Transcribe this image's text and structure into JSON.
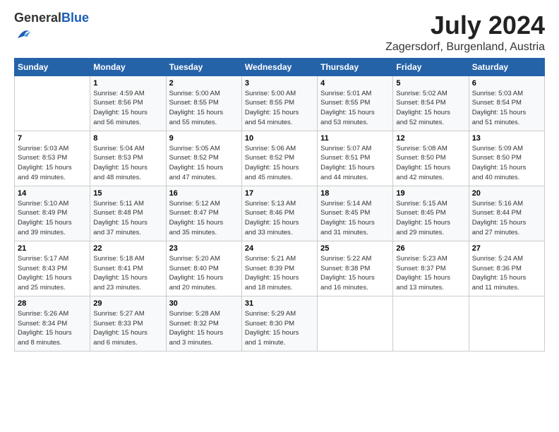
{
  "header": {
    "logo_general": "General",
    "logo_blue": "Blue",
    "title": "July 2024",
    "subtitle": "Zagersdorf, Burgenland, Austria"
  },
  "days_of_week": [
    "Sunday",
    "Monday",
    "Tuesday",
    "Wednesday",
    "Thursday",
    "Friday",
    "Saturday"
  ],
  "weeks": [
    [
      {
        "num": "",
        "info": ""
      },
      {
        "num": "1",
        "info": "Sunrise: 4:59 AM\nSunset: 8:56 PM\nDaylight: 15 hours\nand 56 minutes."
      },
      {
        "num": "2",
        "info": "Sunrise: 5:00 AM\nSunset: 8:55 PM\nDaylight: 15 hours\nand 55 minutes."
      },
      {
        "num": "3",
        "info": "Sunrise: 5:00 AM\nSunset: 8:55 PM\nDaylight: 15 hours\nand 54 minutes."
      },
      {
        "num": "4",
        "info": "Sunrise: 5:01 AM\nSunset: 8:55 PM\nDaylight: 15 hours\nand 53 minutes."
      },
      {
        "num": "5",
        "info": "Sunrise: 5:02 AM\nSunset: 8:54 PM\nDaylight: 15 hours\nand 52 minutes."
      },
      {
        "num": "6",
        "info": "Sunrise: 5:03 AM\nSunset: 8:54 PM\nDaylight: 15 hours\nand 51 minutes."
      }
    ],
    [
      {
        "num": "7",
        "info": "Sunrise: 5:03 AM\nSunset: 8:53 PM\nDaylight: 15 hours\nand 49 minutes."
      },
      {
        "num": "8",
        "info": "Sunrise: 5:04 AM\nSunset: 8:53 PM\nDaylight: 15 hours\nand 48 minutes."
      },
      {
        "num": "9",
        "info": "Sunrise: 5:05 AM\nSunset: 8:52 PM\nDaylight: 15 hours\nand 47 minutes."
      },
      {
        "num": "10",
        "info": "Sunrise: 5:06 AM\nSunset: 8:52 PM\nDaylight: 15 hours\nand 45 minutes."
      },
      {
        "num": "11",
        "info": "Sunrise: 5:07 AM\nSunset: 8:51 PM\nDaylight: 15 hours\nand 44 minutes."
      },
      {
        "num": "12",
        "info": "Sunrise: 5:08 AM\nSunset: 8:50 PM\nDaylight: 15 hours\nand 42 minutes."
      },
      {
        "num": "13",
        "info": "Sunrise: 5:09 AM\nSunset: 8:50 PM\nDaylight: 15 hours\nand 40 minutes."
      }
    ],
    [
      {
        "num": "14",
        "info": "Sunrise: 5:10 AM\nSunset: 8:49 PM\nDaylight: 15 hours\nand 39 minutes."
      },
      {
        "num": "15",
        "info": "Sunrise: 5:11 AM\nSunset: 8:48 PM\nDaylight: 15 hours\nand 37 minutes."
      },
      {
        "num": "16",
        "info": "Sunrise: 5:12 AM\nSunset: 8:47 PM\nDaylight: 15 hours\nand 35 minutes."
      },
      {
        "num": "17",
        "info": "Sunrise: 5:13 AM\nSunset: 8:46 PM\nDaylight: 15 hours\nand 33 minutes."
      },
      {
        "num": "18",
        "info": "Sunrise: 5:14 AM\nSunset: 8:45 PM\nDaylight: 15 hours\nand 31 minutes."
      },
      {
        "num": "19",
        "info": "Sunrise: 5:15 AM\nSunset: 8:45 PM\nDaylight: 15 hours\nand 29 minutes."
      },
      {
        "num": "20",
        "info": "Sunrise: 5:16 AM\nSunset: 8:44 PM\nDaylight: 15 hours\nand 27 minutes."
      }
    ],
    [
      {
        "num": "21",
        "info": "Sunrise: 5:17 AM\nSunset: 8:43 PM\nDaylight: 15 hours\nand 25 minutes."
      },
      {
        "num": "22",
        "info": "Sunrise: 5:18 AM\nSunset: 8:41 PM\nDaylight: 15 hours\nand 23 minutes."
      },
      {
        "num": "23",
        "info": "Sunrise: 5:20 AM\nSunset: 8:40 PM\nDaylight: 15 hours\nand 20 minutes."
      },
      {
        "num": "24",
        "info": "Sunrise: 5:21 AM\nSunset: 8:39 PM\nDaylight: 15 hours\nand 18 minutes."
      },
      {
        "num": "25",
        "info": "Sunrise: 5:22 AM\nSunset: 8:38 PM\nDaylight: 15 hours\nand 16 minutes."
      },
      {
        "num": "26",
        "info": "Sunrise: 5:23 AM\nSunset: 8:37 PM\nDaylight: 15 hours\nand 13 minutes."
      },
      {
        "num": "27",
        "info": "Sunrise: 5:24 AM\nSunset: 8:36 PM\nDaylight: 15 hours\nand 11 minutes."
      }
    ],
    [
      {
        "num": "28",
        "info": "Sunrise: 5:26 AM\nSunset: 8:34 PM\nDaylight: 15 hours\nand 8 minutes."
      },
      {
        "num": "29",
        "info": "Sunrise: 5:27 AM\nSunset: 8:33 PM\nDaylight: 15 hours\nand 6 minutes."
      },
      {
        "num": "30",
        "info": "Sunrise: 5:28 AM\nSunset: 8:32 PM\nDaylight: 15 hours\nand 3 minutes."
      },
      {
        "num": "31",
        "info": "Sunrise: 5:29 AM\nSunset: 8:30 PM\nDaylight: 15 hours\nand 1 minute."
      },
      {
        "num": "",
        "info": ""
      },
      {
        "num": "",
        "info": ""
      },
      {
        "num": "",
        "info": ""
      }
    ]
  ]
}
